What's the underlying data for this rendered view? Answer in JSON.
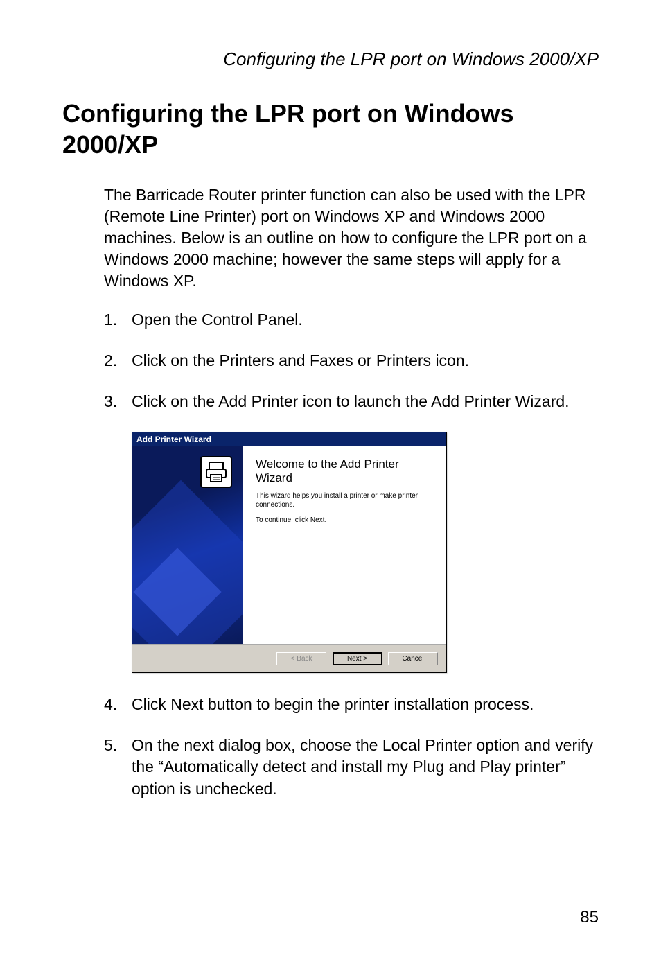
{
  "running_header": "Configuring the LPR port on Windows 2000/XP",
  "heading": "Configuring the LPR port on Windows 2000/XP",
  "intro": "The Barricade Router printer function can also be used with the LPR (Remote Line Printer) port on Windows XP and Windows 2000 machines. Below is an outline on how to configure the LPR port on a Windows 2000 machine; however the same steps will apply for a Windows XP.",
  "steps": [
    {
      "num": "1.",
      "text": "Open the Control Panel."
    },
    {
      "num": "2.",
      "text": "Click on the Printers and Faxes or Printers icon."
    },
    {
      "num": "3.",
      "text": "Click on the Add Printer icon to launch the Add Printer Wizard."
    },
    {
      "num": "4.",
      "text": "Click Next button to begin the printer installation process."
    },
    {
      "num": "5.",
      "text": "On the next dialog box, choose the Local Printer option and verify the “Automatically detect and install my Plug and Play printer” option is unchecked."
    }
  ],
  "wizard": {
    "titlebar": "Add Printer Wizard",
    "welcome": "Welcome to the Add Printer Wizard",
    "description": "This wizard helps you install a printer or make printer connections.",
    "continue": "To continue, click Next.",
    "buttons": {
      "back": "< Back",
      "next": "Next >",
      "cancel": "Cancel"
    }
  },
  "page_number": "85"
}
